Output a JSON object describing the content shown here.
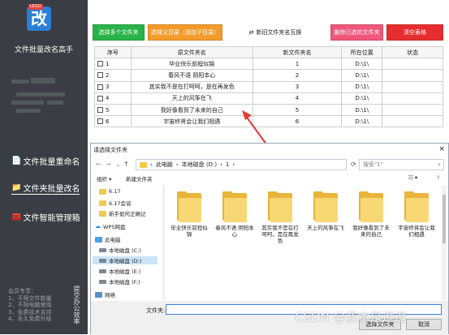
{
  "sidebar": {
    "logo_tag": "LEGO",
    "logo_char": "改",
    "app_title": "文件批量改名高手",
    "nav": [
      {
        "label": "文件批量重命名",
        "icon": "document-icon"
      },
      {
        "label": "文件夹批量改名",
        "icon": "folder-icon"
      },
      {
        "label": "文件智能管理箱",
        "icon": "toolbox-icon"
      }
    ],
    "promo_lines": [
      "会员专享：",
      "1、不限文件数量",
      "2、不限电脑使用",
      "3、免费技术支持",
      "4、永久免费升级"
    ],
    "promo_side": "提交办公效率"
  },
  "toolbar": {
    "buttons": [
      {
        "label": "选择多个文件夹",
        "name": "select-folders-button"
      },
      {
        "label": "选择父目录（添加子目录）",
        "name": "select-parent-dir-button"
      },
      {
        "label": "新旧文件夹名互换",
        "name": "swap-names-button",
        "icon": "swap-icon"
      },
      {
        "label": "删除已选的文件夹",
        "name": "delete-selected-button"
      },
      {
        "label": "清空表格",
        "name": "clear-table-button"
      }
    ]
  },
  "table": {
    "headers": [
      "序号",
      "原文件夹名",
      "新文件夹名",
      "所在位置",
      "状态"
    ],
    "rows": [
      {
        "idx": "1",
        "old": "毕业快乐前程似锦",
        "new": "1",
        "loc": "D:\\1\\",
        "status": ""
      },
      {
        "idx": "2",
        "old": "春风不语 阴阳本心",
        "new": "2",
        "loc": "D:\\1\\",
        "status": ""
      },
      {
        "idx": "3",
        "old": "其实我不是在打呵呵，是在再发色",
        "new": "3",
        "loc": "D:\\1\\",
        "status": ""
      },
      {
        "idx": "4",
        "old": "天上的风筝在飞",
        "new": "4",
        "loc": "D:\\1\\",
        "status": ""
      },
      {
        "idx": "5",
        "old": "我好像看到了未来的自己",
        "new": "5",
        "loc": "D:\\1\\",
        "status": ""
      },
      {
        "idx": "6",
        "old": "宇宙终将会让我们相遇",
        "new": "6",
        "loc": "D:\\1\\",
        "status": ""
      }
    ]
  },
  "dialog": {
    "title": "请选择文件夹",
    "close": "×",
    "address": [
      "此电脑",
      "本地磁盘 (D:)",
      "1"
    ],
    "search_placeholder": "搜索\"1\"",
    "organize": "组织 ▾",
    "new_folder": "新建文件夹",
    "tree": [
      {
        "label": "6.17",
        "type": "folder"
      },
      {
        "label": "6.17会谈",
        "type": "folder"
      },
      {
        "label": "新手如何正确记",
        "type": "folder"
      },
      {
        "label": "WPS网盘",
        "type": "cloud"
      },
      {
        "label": "此电脑",
        "type": "pc"
      },
      {
        "label": "本地磁盘 (C:)",
        "type": "drive"
      },
      {
        "label": "本地磁盘 (D:)",
        "type": "drive"
      },
      {
        "label": "本地磁盘 (E:)",
        "type": "drive"
      },
      {
        "label": "本地磁盘 (F:)",
        "type": "drive"
      },
      {
        "label": "网络",
        "type": "network"
      }
    ],
    "folders": [
      "毕业快乐前程似锦",
      "春风不语 阴阳本心",
      "其实我不是在打呵呵，是在再发色",
      "天上的风筝在飞",
      "我好像看到了未来的自己",
      "宇宙终将会让我们相遇"
    ],
    "filename_label": "文件夹:",
    "filename_value": "",
    "select_button": "选择文件夹",
    "cancel_button": "取消"
  },
  "watermark": "CSDN @我本是逗逗",
  "colors": {
    "sidebar_bg": "#3a3d44",
    "green": "#29b34a",
    "orange": "#f39b2c",
    "pink": "#f0577a",
    "red": "#e62e2e",
    "arrow": "#e53935",
    "selection": "#cce4f7"
  }
}
